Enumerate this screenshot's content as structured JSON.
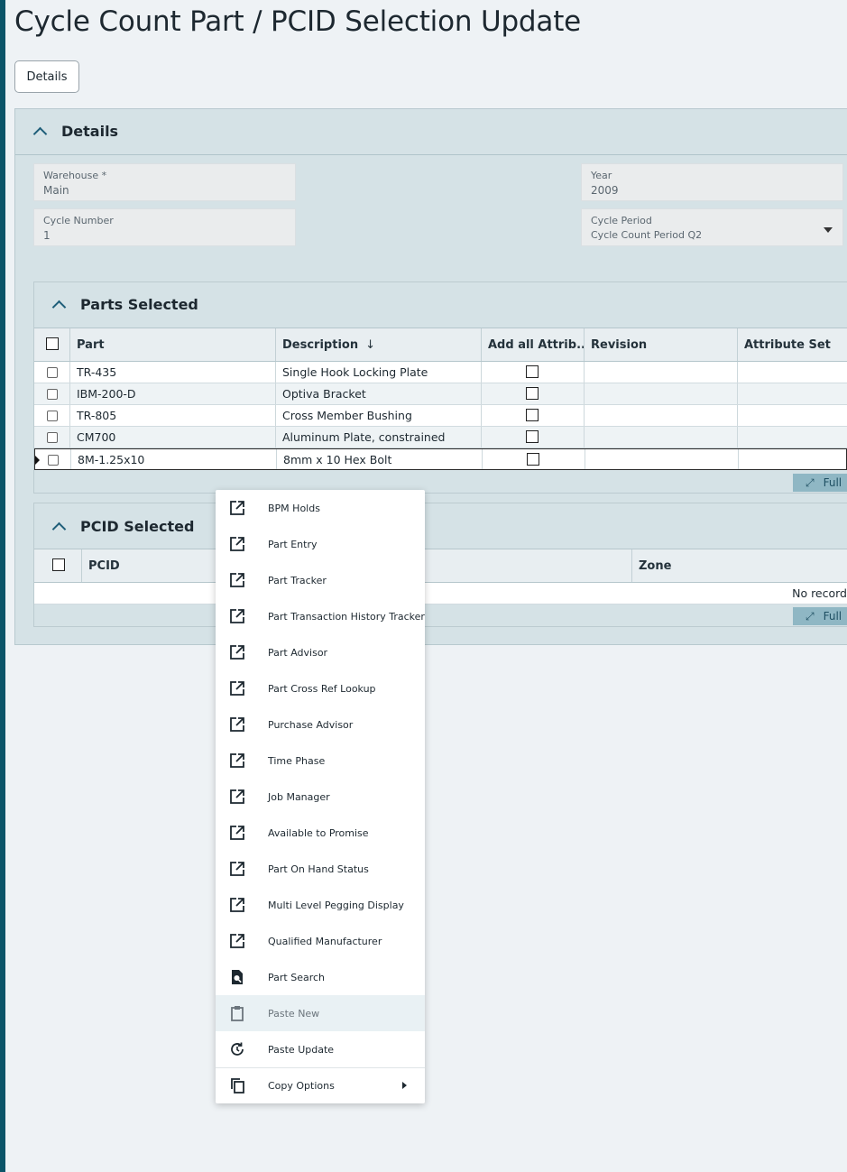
{
  "page_title": "Cycle Count Part / PCID Selection Update",
  "toolbar": {
    "details_button": "Details"
  },
  "details_panel": {
    "title": "Details",
    "fields": {
      "warehouse": {
        "label": "Warehouse *",
        "value": "Main"
      },
      "year": {
        "label": "Year",
        "value": "2009"
      },
      "cycle_number": {
        "label": "Cycle Number",
        "value": "1"
      },
      "cycle_period": {
        "label": "Cycle Period",
        "value": "Cycle Count Period Q2"
      }
    }
  },
  "parts_selected": {
    "title": "Parts Selected",
    "columns": [
      "Part",
      "Description",
      "Add all Attrib...",
      "Revision",
      "Attribute Set"
    ],
    "rows": [
      {
        "part": "TR-435",
        "description": "Single Hook Locking Plate"
      },
      {
        "part": "IBM-200-D",
        "description": "Optiva Bracket"
      },
      {
        "part": "TR-805",
        "description": "Cross Member Bushing"
      },
      {
        "part": "CM700",
        "description": "Aluminum Plate, constrained"
      },
      {
        "part": "8M-1.25x10",
        "description": "8mm x 10 Hex Bolt"
      }
    ],
    "full_button": "Full"
  },
  "pcid_selected": {
    "title": "PCID Selected",
    "columns": [
      "PCID",
      "Zone"
    ],
    "empty_text": "No record",
    "full_button": "Full"
  },
  "context_menu": {
    "items": [
      {
        "label": "BPM Holds",
        "icon": "open-external-icon"
      },
      {
        "label": "Part Entry",
        "icon": "open-external-icon"
      },
      {
        "label": "Part Tracker",
        "icon": "open-external-icon"
      },
      {
        "label": "Part Transaction History Tracker",
        "icon": "open-external-icon"
      },
      {
        "label": "Part Advisor",
        "icon": "open-external-icon"
      },
      {
        "label": "Part Cross Ref Lookup",
        "icon": "open-external-icon"
      },
      {
        "label": "Purchase Advisor",
        "icon": "open-external-icon"
      },
      {
        "label": "Time Phase",
        "icon": "open-external-icon"
      },
      {
        "label": "Job Manager",
        "icon": "open-external-icon"
      },
      {
        "label": "Available to Promise",
        "icon": "open-external-icon"
      },
      {
        "label": "Part On Hand Status",
        "icon": "open-external-icon"
      },
      {
        "label": "Multi Level Pegging Display",
        "icon": "open-external-icon"
      },
      {
        "label": "Qualified Manufacturer",
        "icon": "open-external-icon"
      },
      {
        "label": "Part Search",
        "icon": "document-search-icon"
      },
      {
        "label": "Paste New",
        "icon": "clipboard-icon"
      },
      {
        "label": "Paste Update",
        "icon": "refresh-icon"
      },
      {
        "label": "Copy Options",
        "icon": "copy-icon"
      }
    ]
  },
  "colors": {
    "accent": "#0b5468",
    "panel": "#d5e2e6",
    "full_button": "#8fb7c4"
  }
}
